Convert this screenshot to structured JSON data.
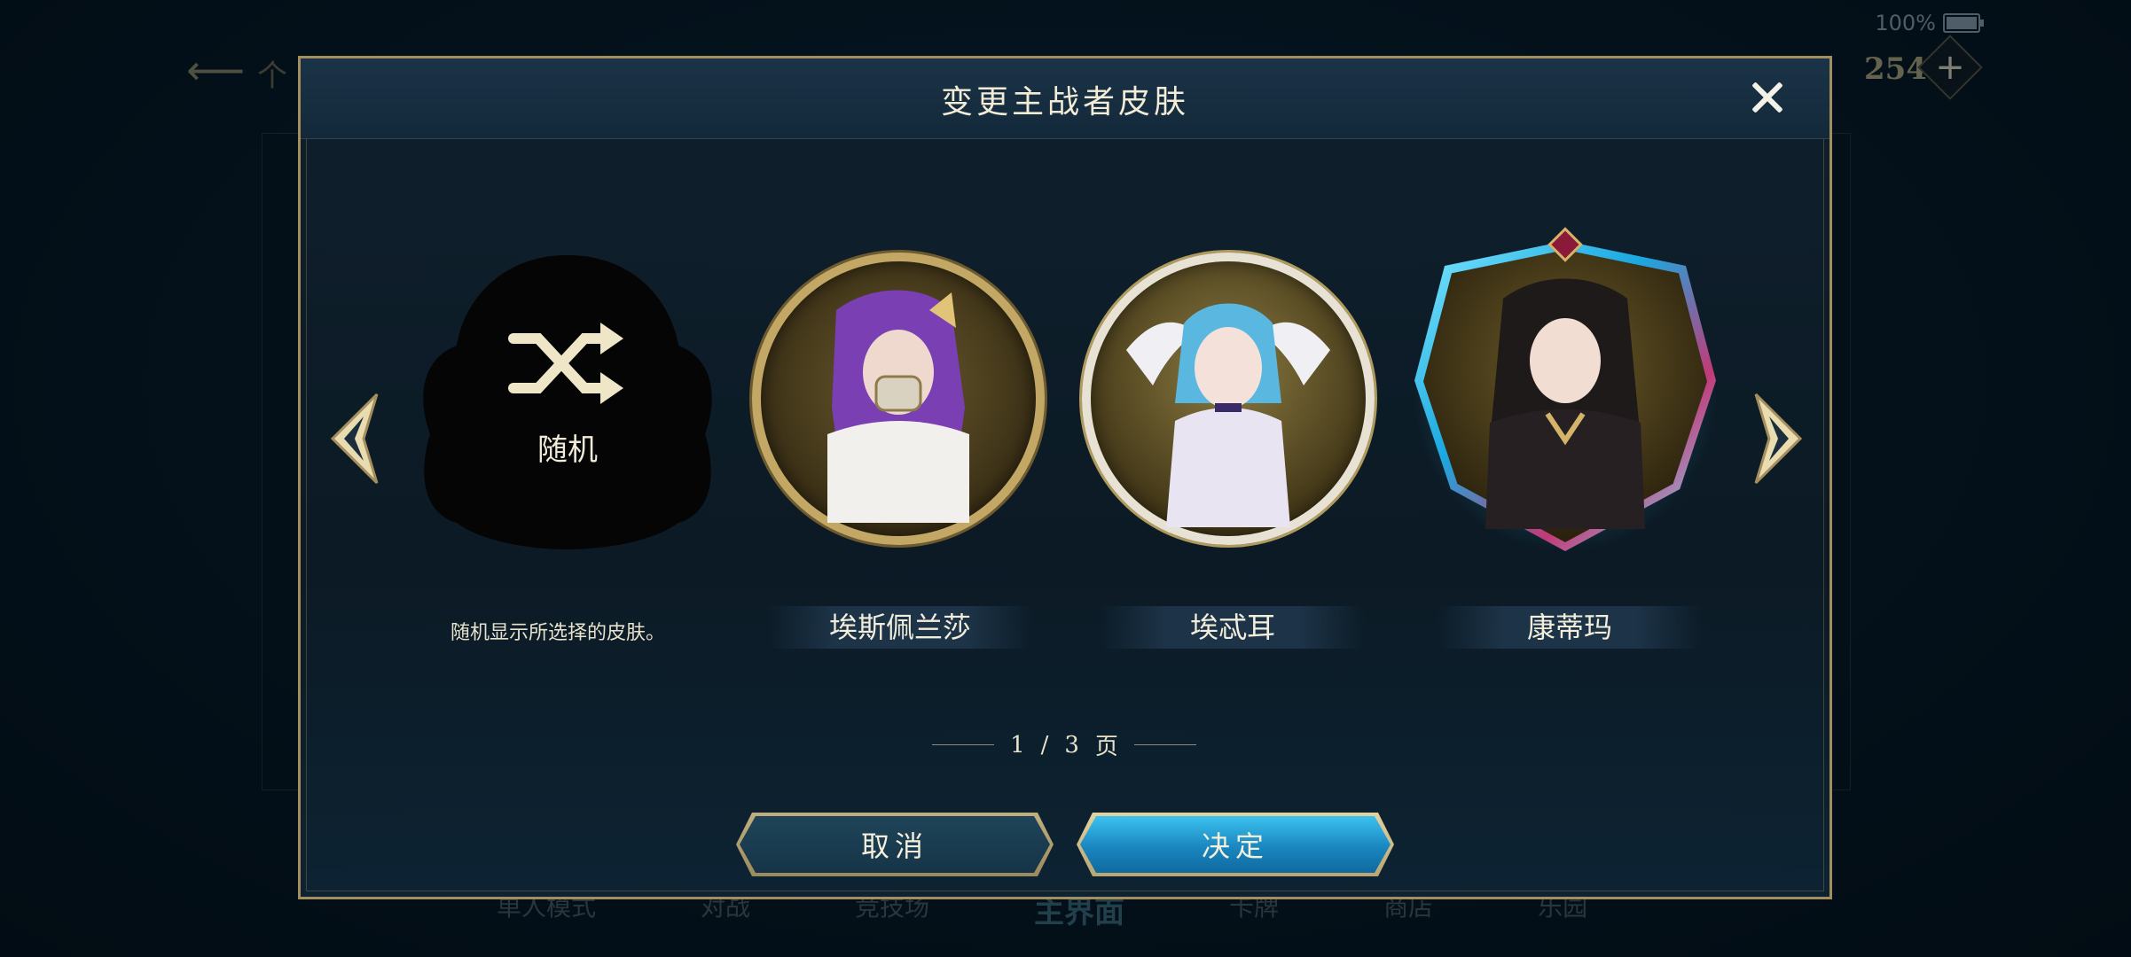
{
  "status_bar": {
    "battery_text": "100%"
  },
  "background": {
    "back_label": "个",
    "currency_value": "254",
    "plus_label": "+",
    "nav_items": [
      "单人模式",
      "对战",
      "竞技场",
      "主界面",
      "卡牌",
      "商店",
      "乐园"
    ]
  },
  "modal": {
    "title": "变更主战者皮肤",
    "random_card": {
      "label": "随机",
      "description": "随机显示所选择的皮肤。"
    },
    "skins": [
      {
        "name": "埃斯佩兰莎"
      },
      {
        "name": "埃忒耳"
      },
      {
        "name": "康蒂玛"
      }
    ],
    "pager": {
      "current": "1",
      "separator": "/",
      "total": "3",
      "unit": "页"
    },
    "buttons": {
      "cancel": "取消",
      "confirm": "决定"
    }
  },
  "icons": [
    "close-icon",
    "arrow-left-icon",
    "arrow-right-icon",
    "shuffle-icon",
    "battery-icon"
  ],
  "colors": {
    "accent_gold": "#c3a865",
    "confirm_blue": "#1a86bf",
    "selection_glow": "#3fd4ff"
  }
}
